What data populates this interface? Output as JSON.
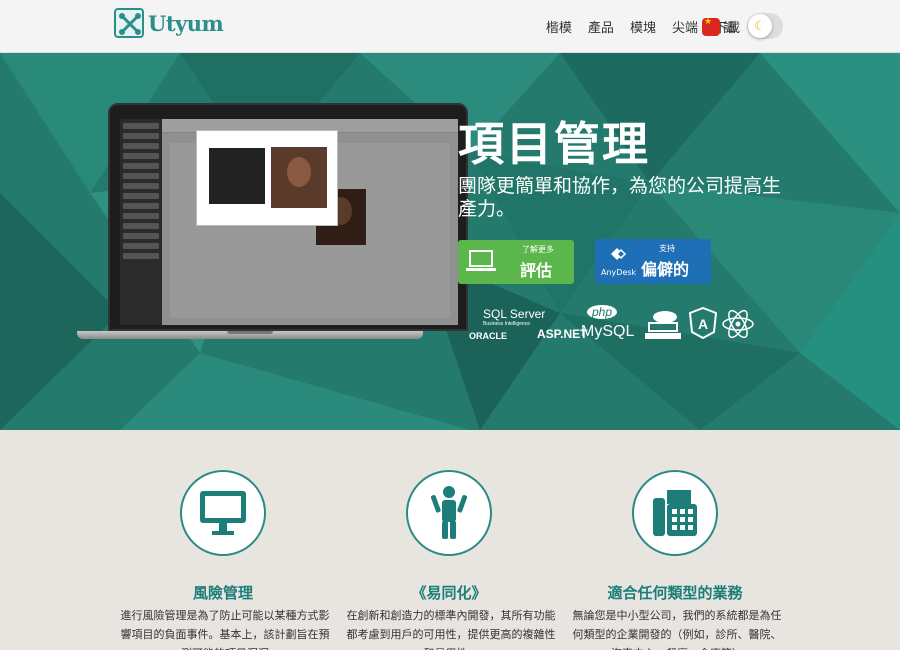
{
  "brand": {
    "name": "Utyum"
  },
  "nav": {
    "items": [
      "楷模",
      "產品",
      "模塊",
      "尖端",
      "下載",
      "接觸"
    ],
    "language": "語"
  },
  "hero": {
    "title": "項目管理",
    "subtitle": "團隊更簡單和協作，為您的公司提高生產力。",
    "btn_eval_small": "了解更多",
    "btn_eval_big": "評估",
    "btn_support_small": "支持",
    "btn_support_big": "偏僻的",
    "btn_support_brand": "AnyDesk"
  },
  "techs": {
    "sqlserver": "SQL Server",
    "sqlserver_sub": "Business Intelligence",
    "oracle": "ORACLE",
    "aspnet": "ASP.NET",
    "php": "php",
    "mysql": "MySQL"
  },
  "features": [
    {
      "title": "風險管理",
      "text": "進行風險管理是為了防止可能以某種方式影響項目的負面事件。基本上，該計劃旨在預測可能的項目漏洞",
      "icon": "monitor-icon"
    },
    {
      "title": "《易同化》",
      "text": "在創新和創造力的標準內開發，其所有功能都考慮到用戶的可用性，提供更高的複雜性和易用性。",
      "icon": "person-icon"
    },
    {
      "title": "適合任何類型的業務",
      "text": "無論您是中小型公司，我們的系統都是為任何類型的企業開發的（例如，診所、醫院、汽車中心、餐廳、倉庫等）",
      "icon": "fax-icon"
    }
  ],
  "colors": {
    "accent": "#1d7e79",
    "hero_bg": "#237a6d",
    "eval_btn": "#5bb64c",
    "support_btn": "#1e6fb5"
  }
}
